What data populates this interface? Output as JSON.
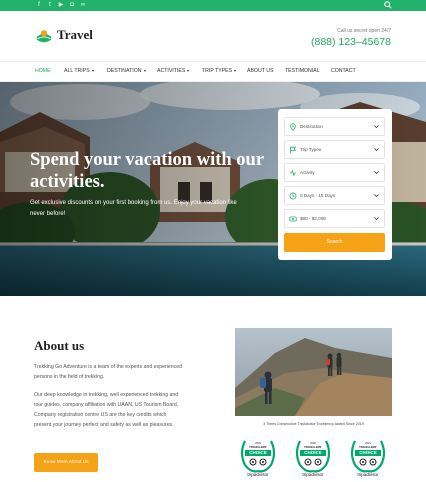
{
  "topbar": {
    "social_icons": [
      "facebook-icon",
      "twitter-icon",
      "youtube-icon",
      "instagram-icon",
      "tripadvisor-icon"
    ],
    "search_icon": "search-icon"
  },
  "header": {
    "logo_text": "Travel",
    "call_label": "Call us secret open 24/7",
    "phone": "(888) 123–45678"
  },
  "nav": {
    "home": "HOME",
    "all_trips": "ALL TRIPS",
    "destination": "DESTINATION",
    "activities": "ACTIVITIES",
    "trip_types": "TRIP TYPES",
    "about_us": "ABOUT US",
    "testimonial": "TESTIMONIAL",
    "contact": "CONTACT"
  },
  "hero": {
    "title": "Spend your vacation with our activities.",
    "subtitle": "Get exclusive discounts on your first booking from us. Enjoy your vacation like never before!"
  },
  "search_form": {
    "destination": "Destination",
    "trip_types": "Trip Types",
    "activity": "Activity",
    "duration": "0 Days - 15 Days",
    "price": "$80 - $2,000",
    "button": "Search"
  },
  "about": {
    "title": "About us",
    "p1": "Trekking Go Adventure is a team of the experts and experienced persons in the field of trekking.",
    "p2": "Our deep knowledge in trekking, well experienced trekking and tour guides, company affiliation with UAAN, US Tourism Board, Company registration centre US are the key credits which present your journey perfect and safety as well as pleasures.",
    "button": "Know More About Us",
    "award_caption": "3 Times Consecutive TripAdvisor Excellency Award Since 2019"
  },
  "awards": [
    {
      "line1": "2019",
      "line2": "TRAVELLERS'",
      "line3": "CHOICE",
      "brand": "tripadvisor"
    },
    {
      "line1": "2020",
      "line2": "TRAVELLERS'",
      "line3": "CHOICE",
      "brand": "tripadvisor"
    },
    {
      "line1": "2021",
      "line2": "TRAVELLERS'",
      "line3": "CHOICE",
      "brand": "tripadvisor"
    }
  ],
  "colors": {
    "brand_green": "#22b26a",
    "accent_orange": "#f6a216",
    "tripadvisor_green": "#00aa6c"
  }
}
